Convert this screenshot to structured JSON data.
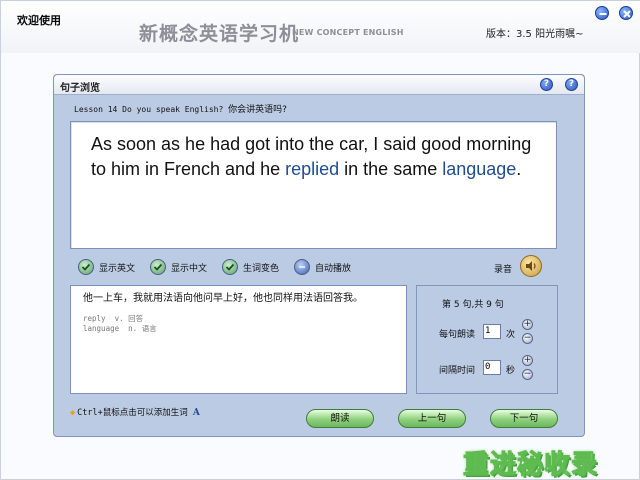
{
  "window": {
    "welcome": "欢迎使用",
    "title_cn": "新概念英语学习机",
    "title_en": "NEW CONCEPT ENGLISH",
    "version": "版本：3.5  阳光雨嘱~",
    "buttons": [
      "minimize-icon",
      "close-icon"
    ]
  },
  "dialog": {
    "title": "句子浏览",
    "lesson_en": "Lesson 14 Do you speak English?",
    "lesson_cn": "你会讲英语吗?",
    "sentence": {
      "part1": "As soon as he had got into the car, I said good morning to him in French and he ",
      "highlight1": "replied",
      "part2": " in the same ",
      "highlight2": "language",
      "part3": "."
    },
    "options": [
      {
        "label": "显示英文",
        "checked": true
      },
      {
        "label": "显示中文",
        "checked": true
      },
      {
        "label": "生词变色",
        "checked": true
      },
      {
        "label": "自动播放",
        "checked": false
      }
    ],
    "record_label": "录音",
    "translation": "他一上车，我就用法语向他问早上好，他也同样用法语回答我。",
    "vocab": [
      "reply  v. 回答",
      "language  n. 语言"
    ],
    "settings": {
      "sentence_count": "第 5 句,共 9 句",
      "repeat_label": "每句朗读",
      "repeat_value": "1",
      "repeat_unit": "次",
      "interval_label": "间隔时间",
      "interval_value": "0",
      "interval_unit": "秒"
    },
    "hint": "Ctrl+鼠标点击可以添加生词",
    "hint_icon": "A",
    "buttons": {
      "read": "朗读",
      "prev": "上一句",
      "next": "下一句"
    }
  },
  "watermark": "重进秘收录",
  "colors": {
    "dialog_bg": "#bccbe4",
    "highlight": "#1f4c8e",
    "pill_green": "#8fd07c"
  }
}
